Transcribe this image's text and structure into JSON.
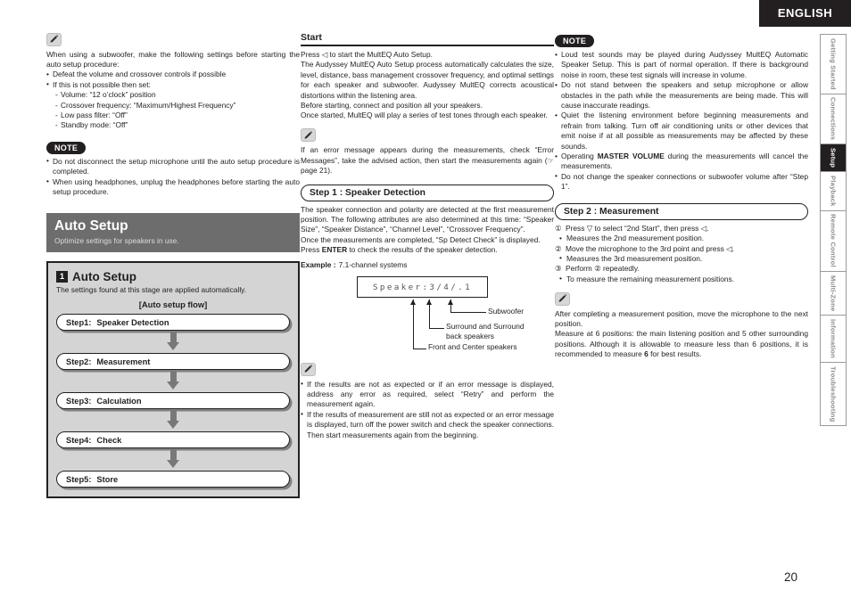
{
  "header": {
    "language": "ENGLISH"
  },
  "sidebar": {
    "tabs": [
      {
        "label": "Getting Started",
        "active": false
      },
      {
        "label": "Connections",
        "active": false
      },
      {
        "label": "Setup",
        "active": true
      },
      {
        "label": "Playback",
        "active": false
      },
      {
        "label": "Remote Control",
        "active": false
      },
      {
        "label": "Multi-Zone",
        "active": false
      },
      {
        "label": "Information",
        "active": false
      },
      {
        "label": "Troubleshooting",
        "active": false
      }
    ]
  },
  "page_number": "20",
  "column1": {
    "memo1_intro": "When using a subwoofer, make the following settings before starting the auto setup procedure:",
    "memo1_b1": "Defeat the volume and crossover controls if possible",
    "memo1_b2": "If this is not possible then set:",
    "memo1_s1": "Volume: “12 o’clock” position",
    "memo1_s2": "Crossover frequency: “Maximum/Highest Frequency”",
    "memo1_s3": "Low pass filter: “Off”",
    "memo1_s4": "Standby mode: “Off”",
    "note_label": "NOTE",
    "note_b1": "Do not disconnect the setup microphone until the auto setup procedure is completed.",
    "note_b2": "When using headphones, unplug the headphones before starting the auto setup procedure.",
    "banner_title": "Auto Setup",
    "banner_sub": "Optimize settings for speakers in use.",
    "flow_num": "1",
    "flow_title": "Auto Setup",
    "flow_sub": "The settings found at this stage are applied automatically.",
    "flow_caption": "[Auto setup flow]",
    "steps": [
      {
        "num": "Step1:",
        "label": "Speaker Detection"
      },
      {
        "num": "Step2:",
        "label": "Measurement"
      },
      {
        "num": "Step3:",
        "label": "Calculation"
      },
      {
        "num": "Step4:",
        "label": "Check"
      },
      {
        "num": "Step5:",
        "label": "Store"
      }
    ]
  },
  "column2": {
    "start_head": "Start",
    "start_p1": "Press ◁ to start the MultEQ Auto Setup.",
    "start_p2": "The Audyssey MultEQ Auto Setup process automatically calculates the size, level, distance, bass management crossover frequency, and optimal settings for each speaker and subwoofer. Audyssey MultEQ corrects acoustical distortions within the listening area.",
    "start_p3": "Before starting, connect and position all your speakers.",
    "start_p4": "Once started, MultEQ will play a series of test tones through each speaker.",
    "memo_p": "If an error message appears during the measurements, check “Error Messages”, take the advised action, then start the measurements again (☞ page 21).",
    "step1_bar": "Step 1 : Speaker Detection",
    "step1_p1": "The speaker connection and polarity are detected at the first measurement position. The following attributes are also determined at this time: “Speaker Size”, “Speaker Distance”, “Channel Level”, “Crossover Frequency”.",
    "step1_p2": "Once the measurements are completed, “Sp Detect Check” is displayed.",
    "step1_p3_pre": "Press ",
    "step1_p3_bold": "ENTER",
    "step1_p3_post": " to check the results of the speaker detection.",
    "example_label": "Example :",
    "example_value": "7.1-channel systems",
    "lcd_text": "Speaker:3/4/.1",
    "callout_subwoofer": "Subwoofer",
    "callout_surround": "Surround and Surround back speakers",
    "callout_front": "Front and Center speakers",
    "memo2_b1": "If the results are not as expected or if an error message is displayed, address any error as required, select “Retry” and perform the measurement again.",
    "memo2_b2": "If the results of measurement are still not as expected or an error message is displayed, turn off the power switch and check the speaker connections. Then start measurements again from the beginning."
  },
  "column3": {
    "note_label": "NOTE",
    "note_b1": "Loud test sounds may be played during Audyssey MultEQ Automatic Speaker Setup. This is part of normal operation.  If there is background noise in room, these test signals will increase in volume.",
    "note_b2": "Do not stand between the speakers and setup microphone or allow obstacles in the path while the measurements are being made. This will cause inaccurate readings.",
    "note_b3": "Quiet the listening environment before beginning measurements and refrain from talking. Turn off air conditioning units or other devices that emit noise if at all possible as measurements may be affected by these sounds.",
    "note_b4_pre": "Operating ",
    "note_b4_bold": "MASTER VOLUME",
    "note_b4_post": " during the measurements will cancel the measurements.",
    "note_b5": "Do not change the speaker connections or subwoofer volume after “Step 1”.",
    "step2_bar": "Step 2 : Measurement",
    "item1_num": "①",
    "item1_text": "Press ▽ to select “2nd Start”, then press ◁.",
    "item1_sub": "Measures the 2nd measurement position.",
    "item2_num": "②",
    "item2_text": "Move the microphone to the 3rd point and press ◁.",
    "item2_sub": "Measures the 3rd measurement position.",
    "item3_num": "③",
    "item3_text": "Perform ② repeatedly.",
    "item3_sub": "To measure the remaining measurement positions.",
    "memo_p1": "After completing a measurement position, move the microphone to the next position.",
    "memo_p2_pre": "Measure at 6 positions: the main listening position and 5 other surrounding positions. Although it is allowable to measure less than 6 positions, it is recommended to measure ",
    "memo_p2_bold": "6",
    "memo_p2_post": " for best results."
  }
}
